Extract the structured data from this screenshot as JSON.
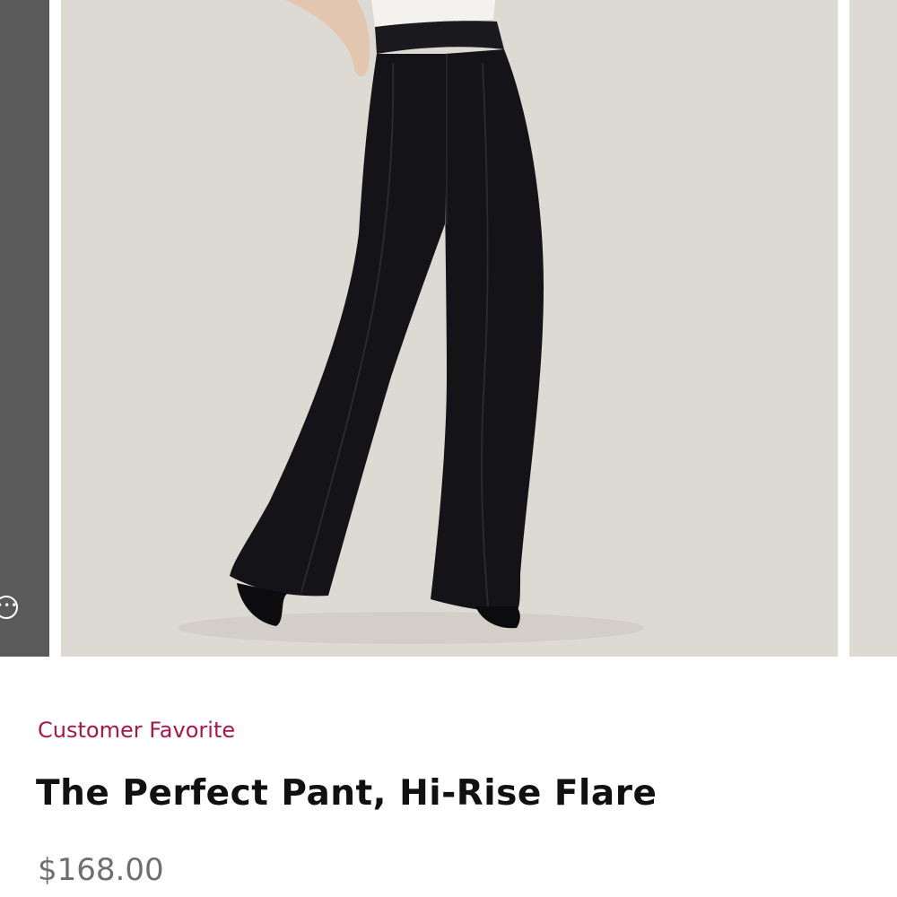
{
  "carousel": {
    "prev_more_icon": "more-dots-icon",
    "main_image_alt": "black hi-rise flare pants",
    "colors": {
      "backdrop": "#ddd9d3",
      "pants": "#141317",
      "prev_panel": "#5a5a5a"
    }
  },
  "product": {
    "badge": "Customer Favorite",
    "badge_color": "#a4184a",
    "title": "The Perfect Pant, Hi-Rise Flare",
    "price": "$168.00"
  }
}
